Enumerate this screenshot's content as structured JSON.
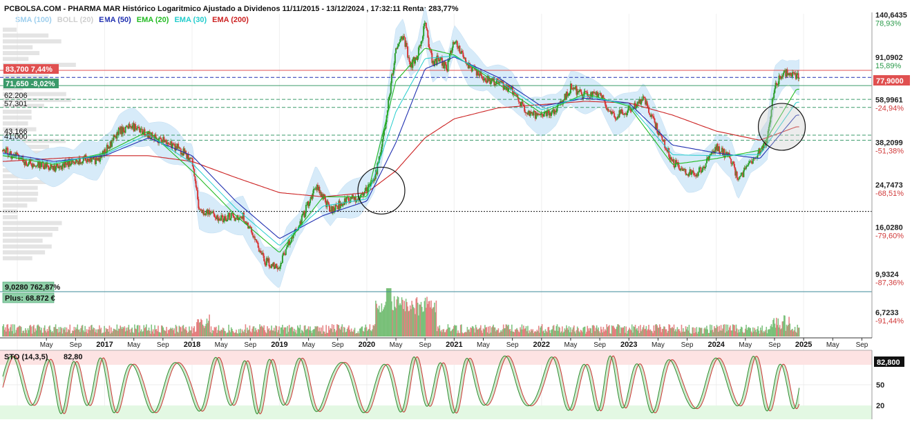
{
  "header": {
    "title": "PCBOLSA.COM - PHARMA MAR Histórico Logaritmico Ajustado a Dividenos 11/11/2015 - 13/12/2024 , 17:32:11 Renta: 283,77%"
  },
  "legend": [
    {
      "label": "SMA (100)",
      "color": "#9ecfee"
    },
    {
      "label": "BOLL (20)",
      "color": "#cfcfcf"
    },
    {
      "label": "EMA (50)",
      "color": "#1f2fb0"
    },
    {
      "label": "EMA (20)",
      "color": "#22bb22"
    },
    {
      "label": "EMA (30)",
      "color": "#22cccc"
    },
    {
      "label": "EMA (200)",
      "color": "#cc2222"
    }
  ],
  "colors": {
    "up": "#2e9e2e",
    "down": "#d63a3a",
    "band": "#d7ebf9",
    "ema20": "#22bb22",
    "ema30": "#22cccc",
    "ema50": "#1f2fb0",
    "ema200": "#cc2222",
    "stoK": "#2d8a2d",
    "stoD": "#cc3333",
    "badgeRed": "#e05050",
    "badgeGreen": "#3a9a6a"
  },
  "price_badges": {
    "last": "77,9000",
    "resistance": "83,700  7,44%",
    "support": "71,650  -8,02%",
    "low_info": "9,0280  762,87%",
    "plus_info": "Plus: 68.872 €"
  },
  "left_levels": [
    "62.206",
    "57,301",
    "43,166",
    "41,000"
  ],
  "y_axis": [
    {
      "price": "140,6435",
      "pct": "78,93%"
    },
    {
      "price": "91,0902",
      "pct": "15,89%"
    },
    {
      "price": "58,9961",
      "pct": "-24,94%"
    },
    {
      "price": "38,2099",
      "pct": "-51,38%"
    },
    {
      "price": "24,7473",
      "pct": "-68,51%"
    },
    {
      "price": "16,0280",
      "pct": "-79,60%"
    },
    {
      "price": "9,9324",
      "pct": "-87,36%"
    },
    {
      "price": "6,7233",
      "pct": "-91,44%"
    }
  ],
  "x_axis": [
    "May",
    "Sep",
    "2017",
    "May",
    "Sep",
    "2018",
    "May",
    "Sep",
    "2019",
    "May",
    "Sep",
    "2020",
    "May",
    "Sep",
    "2021",
    "May",
    "Sep",
    "2022",
    "May",
    "Sep",
    "2023",
    "May",
    "Sep",
    "2024",
    "May",
    "Sep",
    "2025",
    "May",
    "Sep"
  ],
  "stochastic": {
    "label": "STO (14,3,5)",
    "value": "82,80",
    "badge": "82,800",
    "levels": [
      "50",
      "20"
    ]
  },
  "chart_data": {
    "type": "line",
    "title": "PHARMA MAR Histórico Logaritmico Ajustado a Dividenos 11/11/2015 - 13/12/2024",
    "scale": "log",
    "ylim": [
      6.7,
      142
    ],
    "series": [
      {
        "name": "Price",
        "points": [
          [
            "2015-11",
            37
          ],
          [
            "2016-03",
            32
          ],
          [
            "2016-06",
            31
          ],
          [
            "2016-10",
            34
          ],
          [
            "2016-12",
            33
          ],
          [
            "2017-03",
            45
          ],
          [
            "2017-05",
            47
          ],
          [
            "2017-08",
            42
          ],
          [
            "2017-11",
            38
          ],
          [
            "2018-01",
            34
          ],
          [
            "2018-02",
            20
          ],
          [
            "2018-05",
            18.5
          ],
          [
            "2018-08",
            19
          ],
          [
            "2018-11",
            12
          ],
          [
            "2019-01",
            11
          ],
          [
            "2019-02",
            14
          ],
          [
            "2019-04",
            18
          ],
          [
            "2019-06",
            26
          ],
          [
            "2019-08",
            20
          ],
          [
            "2019-10",
            22
          ],
          [
            "2019-12",
            23
          ],
          [
            "2020-02",
            27
          ],
          [
            "2020-03",
            37
          ],
          [
            "2020-04",
            62
          ],
          [
            "2020-05",
            105
          ],
          [
            "2020-06",
            120
          ],
          [
            "2020-07",
            88
          ],
          [
            "2020-08",
            98
          ],
          [
            "2020-09",
            135
          ],
          [
            "2020-10",
            90
          ],
          [
            "2020-11",
            95
          ],
          [
            "2020-12",
            85
          ],
          [
            "2021-01",
            115
          ],
          [
            "2021-03",
            87
          ],
          [
            "2021-05",
            78
          ],
          [
            "2021-07",
            74
          ],
          [
            "2021-09",
            68
          ],
          [
            "2021-11",
            55
          ],
          [
            "2022-01",
            52
          ],
          [
            "2022-03",
            56
          ],
          [
            "2022-05",
            70
          ],
          [
            "2022-07",
            65
          ],
          [
            "2022-09",
            65
          ],
          [
            "2022-11",
            52
          ],
          [
            "2023-01",
            56
          ],
          [
            "2023-03",
            63
          ],
          [
            "2023-05",
            45
          ],
          [
            "2023-07",
            33
          ],
          [
            "2023-09",
            29
          ],
          [
            "2023-11",
            30
          ],
          [
            "2024-01",
            38
          ],
          [
            "2024-03",
            34
          ],
          [
            "2024-04",
            27
          ],
          [
            "2024-06",
            34
          ],
          [
            "2024-08",
            41
          ],
          [
            "2024-09",
            72
          ],
          [
            "2024-10",
            80
          ],
          [
            "2024-11",
            82
          ],
          [
            "2024-12",
            77.9
          ]
        ]
      },
      {
        "name": "EMA (200)",
        "points": [
          [
            "2015-11",
            33
          ],
          [
            "2016-06",
            34
          ],
          [
            "2017-01",
            35
          ],
          [
            "2017-07",
            35
          ],
          [
            "2018-01",
            33
          ],
          [
            "2018-07",
            28
          ],
          [
            "2019-01",
            24
          ],
          [
            "2019-07",
            23
          ],
          [
            "2020-01",
            24
          ],
          [
            "2020-05",
            30
          ],
          [
            "2020-09",
            42
          ],
          [
            "2021-01",
            51
          ],
          [
            "2021-07",
            57
          ],
          [
            "2022-01",
            59
          ],
          [
            "2022-07",
            61
          ],
          [
            "2023-01",
            60
          ],
          [
            "2023-07",
            53
          ],
          [
            "2024-01",
            45
          ],
          [
            "2024-07",
            41
          ],
          [
            "2024-12",
            47
          ]
        ]
      },
      {
        "name": "EMA (50)",
        "points": [
          [
            "2015-11",
            36
          ],
          [
            "2016-06",
            33
          ],
          [
            "2017-01",
            35
          ],
          [
            "2017-07",
            42
          ],
          [
            "2018-01",
            35
          ],
          [
            "2018-07",
            22
          ],
          [
            "2019-01",
            15
          ],
          [
            "2019-07",
            19
          ],
          [
            "2020-01",
            22
          ],
          [
            "2020-05",
            40
          ],
          [
            "2020-09",
            85
          ],
          [
            "2021-01",
            96
          ],
          [
            "2021-07",
            78
          ],
          [
            "2022-01",
            58
          ],
          [
            "2022-07",
            63
          ],
          [
            "2023-01",
            60
          ],
          [
            "2023-07",
            39
          ],
          [
            "2024-01",
            36
          ],
          [
            "2024-07",
            34
          ],
          [
            "2024-12",
            53
          ]
        ]
      },
      {
        "name": "EMA (20)",
        "points": [
          [
            "2015-11",
            35
          ],
          [
            "2016-06",
            32
          ],
          [
            "2017-01",
            36
          ],
          [
            "2017-07",
            45
          ],
          [
            "2018-01",
            30
          ],
          [
            "2018-07",
            19
          ],
          [
            "2019-01",
            13
          ],
          [
            "2019-07",
            23
          ],
          [
            "2020-01",
            23
          ],
          [
            "2020-05",
            75
          ],
          [
            "2020-09",
            105
          ],
          [
            "2021-01",
            98
          ],
          [
            "2021-07",
            73
          ],
          [
            "2022-01",
            54
          ],
          [
            "2022-07",
            66
          ],
          [
            "2023-01",
            58
          ],
          [
            "2023-07",
            32
          ],
          [
            "2024-01",
            34
          ],
          [
            "2024-07",
            37
          ],
          [
            "2024-12",
            69
          ]
        ]
      }
    ],
    "levels": [
      {
        "price": 83.7,
        "style": "solid",
        "color": "#e05050"
      },
      {
        "price": 77.9,
        "style": "dashed",
        "color": "#1f2fb0"
      },
      {
        "price": 71.65,
        "style": "solid",
        "color": "#3a9a6a"
      },
      {
        "price": 62.206,
        "style": "dashed",
        "color": "#3a9a6a"
      },
      {
        "price": 57.301,
        "style": "dashed",
        "color": "#3a9a6a"
      },
      {
        "price": 43.166,
        "style": "dashed",
        "color": "#3a9a6a"
      },
      {
        "price": 41.0,
        "style": "dashed",
        "color": "#3a9a6a"
      },
      {
        "price": 19.8,
        "style": "dotted",
        "color": "#111111"
      }
    ],
    "highlights": [
      {
        "date": "2020-03",
        "price": 24.5
      },
      {
        "date": "2024-10",
        "price": 47
      }
    ]
  }
}
